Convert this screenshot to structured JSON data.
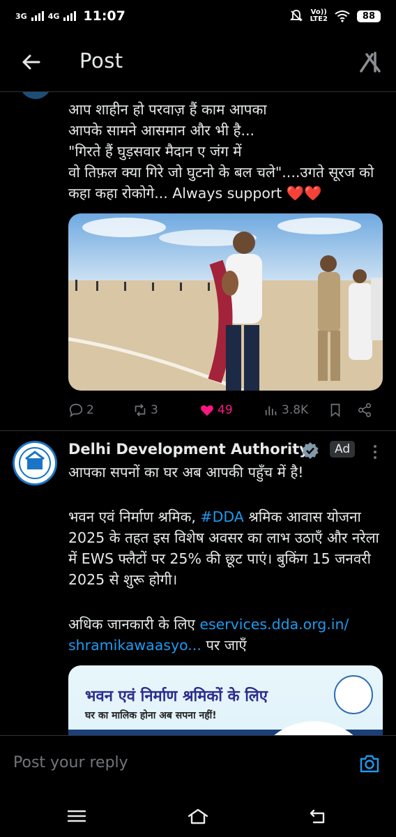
{
  "status_bar": {
    "net1": "3G",
    "net2": "4G",
    "time": "11:07",
    "volte_top": "Vo))",
    "volte_bottom": "LTE2",
    "battery": "88"
  },
  "header": {
    "title": "Post"
  },
  "tweet": {
    "text": "आप शाहीन हो परवाज़ हैं काम आपका\nआपके सामने आसमान और भी है...\n\"गिरते हैं घुड़सवार मैदान ए जंग में\nवो तिफ़ल क्या गिरे जो घुटनो के बल चले\"....उगते सूरज को कहा कहा रोकोगे... Always support ❤️❤️",
    "replies": "2",
    "reposts": "3",
    "likes": "49",
    "views": "3.8K"
  },
  "ad_post": {
    "name": "Delhi Development Authority",
    "ad_label": "Ad",
    "line1": "आपका सपनों का घर अब आपकी पहुँच में है!",
    "para_pre": "भवन एवं निर्माण श्रमिक, ",
    "hashtag": "#DDA",
    "para_post": " श्रमिक आवास योजना 2025 के तहत इस विशेष अवसर का लाभ उठाएँ और नरेला में EWS फ्लैटों पर 25% की छूट पाएं। बुकिंग 15 जनवरी 2025 से शुरू होगी।",
    "more_pre": "अधिक जानकारी के लिए ",
    "link": "eservices.dda.org.in/\nshramikawaasyo...",
    "more_post": " पर जाएँ",
    "card_heading": "भवन एवं निर्माण श्रमिकों के लिए",
    "card_sub": "घर का मालिक होना अब सपना नहीं!"
  },
  "reply_bar": {
    "placeholder": "Post your reply"
  },
  "colors": {
    "background": "#000000",
    "text": "#e7e9ea",
    "muted": "#71767b",
    "link": "#1d9bf0",
    "like": "#f91880",
    "divider": "#2f3336"
  }
}
